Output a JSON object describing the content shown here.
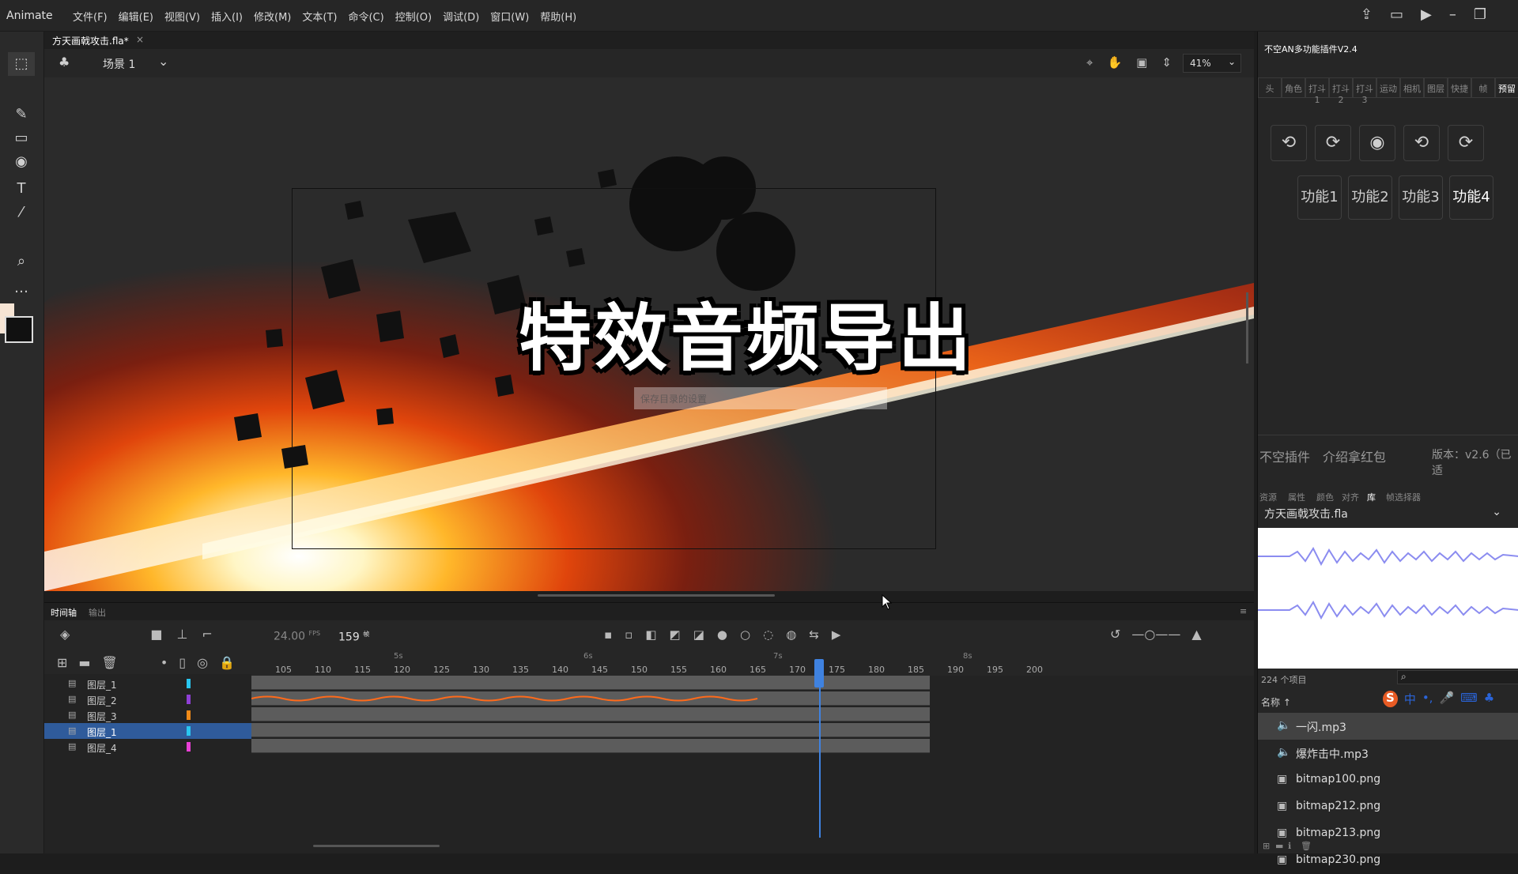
{
  "app": {
    "name": "Animate"
  },
  "menu": [
    "文件(F)",
    "编辑(E)",
    "视图(V)",
    "插入(I)",
    "修改(M)",
    "文本(T)",
    "命令(C)",
    "控制(O)",
    "调试(D)",
    "窗口(W)",
    "帮助(H)"
  ],
  "document": {
    "tab": "方天画戟攻击.fla*",
    "close": "×"
  },
  "scene": {
    "label": "场景 1",
    "zoom": "41%"
  },
  "stage": {
    "title_text": "特效音频导出",
    "ghost_input": "保存目录的设置"
  },
  "timeline": {
    "tab_active": "时间轴",
    "tab_output": "输出",
    "fps": "24.00",
    "fps_unit": "FPS",
    "current_frame": "159",
    "frame_unit": "帧",
    "seconds": [
      "5s",
      "6s",
      "7s",
      "8s"
    ],
    "ticks": [
      "105",
      "110",
      "115",
      "120",
      "125",
      "130",
      "135",
      "140",
      "145",
      "150",
      "155",
      "160",
      "165",
      "170",
      "175",
      "180",
      "185",
      "190",
      "195",
      "200"
    ],
    "layers": [
      {
        "name": "图层_1",
        "color": "#29c6f0",
        "selected": false
      },
      {
        "name": "图层_2",
        "color": "#8f3fd6",
        "selected": false
      },
      {
        "name": "图层_3",
        "color": "#f08a18",
        "selected": false
      },
      {
        "name": "图层_1",
        "color": "#29c6f0",
        "selected": true
      },
      {
        "name": "图层_4",
        "color": "#e93fd6",
        "selected": false
      }
    ]
  },
  "plugin": {
    "title": "不空AN多功能插件V2.4",
    "tabs": [
      "头",
      "角色",
      "打斗1",
      "打斗2",
      "打斗3",
      "运动",
      "相机",
      "图层",
      "快捷",
      "帧",
      "预留"
    ],
    "functions": [
      "功能1",
      "功能2",
      "功能3",
      "功能4"
    ],
    "footer_left": "不空插件",
    "footer_mid": "介绍拿红包",
    "footer_right": "版本：v2.6（已适"
  },
  "library": {
    "tabs": [
      "资源",
      "属性",
      "颜色",
      "对齐",
      "库",
      "帧选择器"
    ],
    "file": "方天画戟攻击.fla",
    "count": "224 个项目",
    "name_header": "名称 ↑",
    "items": [
      {
        "icon": "speaker-icon",
        "name": "一闪.mp3",
        "selected": true
      },
      {
        "icon": "speaker-icon",
        "name": "爆炸击中.mp3",
        "selected": false
      },
      {
        "icon": "image-icon",
        "name": "bitmap100.png",
        "selected": false
      },
      {
        "icon": "image-icon",
        "name": "bitmap212.png",
        "selected": false
      },
      {
        "icon": "image-icon",
        "name": "bitmap213.png",
        "selected": false
      },
      {
        "icon": "image-icon",
        "name": "bitmap230.png",
        "selected": false
      }
    ]
  },
  "ime": {
    "logo": "S",
    "lang": "中"
  }
}
